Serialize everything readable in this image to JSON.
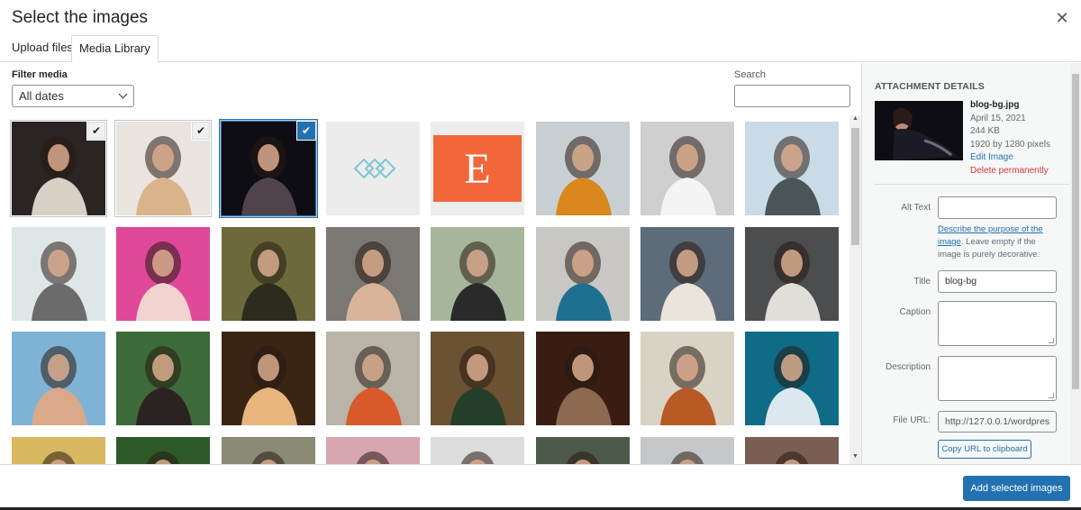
{
  "modal": {
    "title": "Select the images",
    "close_icon": "close-icon"
  },
  "tabs": [
    {
      "label": "Upload files",
      "active": false
    },
    {
      "label": "Media Library",
      "active": true
    }
  ],
  "toolbar": {
    "filter_label": "Filter media",
    "filter_value": "All dates",
    "search_label": "Search",
    "search_value": ""
  },
  "grid": {
    "tiles": [
      {
        "row": 0,
        "col": 0,
        "bg": "#2a2522",
        "fg": "#d8cfc5",
        "selected": true,
        "focused": false,
        "check": "✔"
      },
      {
        "row": 0,
        "col": 1,
        "bg": "#e9e4df",
        "fg": "#d9b48a",
        "selected": true,
        "focused": false,
        "check": "✔"
      },
      {
        "row": 0,
        "col": 2,
        "bg": "#0e0d14",
        "fg": "#51434a",
        "selected": true,
        "focused": true,
        "check": "✔"
      },
      {
        "row": 0,
        "col": 3,
        "bg": "#ececec",
        "fg": "#7fc6d2",
        "selected": false,
        "focused": false,
        "check": ""
      },
      {
        "row": 0,
        "col": 4,
        "bg": "#ededed",
        "fg": "#f26639",
        "selected": false,
        "focused": false,
        "check": ""
      },
      {
        "row": 0,
        "col": 5,
        "bg": "#c8cfd2",
        "fg": "#d9861c",
        "selected": false,
        "focused": false,
        "check": ""
      },
      {
        "row": 0,
        "col": 6,
        "bg": "#cfcfcf",
        "fg": "#f4f4f4",
        "selected": false,
        "focused": false,
        "check": ""
      },
      {
        "row": 0,
        "col": 7,
        "bg": "#c9dbe6",
        "fg": "#4a5558",
        "selected": false,
        "focused": false,
        "check": ""
      },
      {
        "row": 1,
        "col": 0,
        "bg": "#dfe6e8",
        "fg": "#6b6b6b",
        "selected": false,
        "focused": false,
        "check": ""
      },
      {
        "row": 1,
        "col": 1,
        "bg": "#e0489a",
        "fg": "#f1d3cf",
        "selected": false,
        "focused": false,
        "check": ""
      },
      {
        "row": 1,
        "col": 2,
        "bg": "#6c6a3c",
        "fg": "#2c2c1e",
        "selected": false,
        "focused": false,
        "check": ""
      },
      {
        "row": 1,
        "col": 3,
        "bg": "#7b7772",
        "fg": "#d9b49a",
        "selected": false,
        "focused": false,
        "check": ""
      },
      {
        "row": 1,
        "col": 4,
        "bg": "#a7b69a",
        "fg": "#2a2a2a",
        "selected": false,
        "focused": false,
        "check": ""
      },
      {
        "row": 1,
        "col": 5,
        "bg": "#c9c7c3",
        "fg": "#1f6f91",
        "selected": false,
        "focused": false,
        "check": ""
      },
      {
        "row": 1,
        "col": 6,
        "bg": "#5d6c78",
        "fg": "#e9e4dc",
        "selected": false,
        "focused": false,
        "check": ""
      },
      {
        "row": 1,
        "col": 7,
        "bg": "#4b4d4f",
        "fg": "#e1ddd7",
        "selected": false,
        "focused": false,
        "check": ""
      },
      {
        "row": 2,
        "col": 0,
        "bg": "#7fb3d6",
        "fg": "#d9a98a",
        "selected": false,
        "focused": false,
        "check": ""
      },
      {
        "row": 2,
        "col": 1,
        "bg": "#3d6b3a",
        "fg": "#2b2322",
        "selected": false,
        "focused": false,
        "check": ""
      },
      {
        "row": 2,
        "col": 2,
        "bg": "#3a2414",
        "fg": "#e8b67c",
        "selected": false,
        "focused": false,
        "check": ""
      },
      {
        "row": 2,
        "col": 3,
        "bg": "#b9b3a8",
        "fg": "#d85a2b",
        "selected": false,
        "focused": false,
        "check": ""
      },
      {
        "row": 2,
        "col": 4,
        "bg": "#6b5233",
        "fg": "#253e29",
        "selected": false,
        "focused": false,
        "check": ""
      },
      {
        "row": 2,
        "col": 5,
        "bg": "#3a1d12",
        "fg": "#8d6a4f",
        "selected": false,
        "focused": false,
        "check": ""
      },
      {
        "row": 2,
        "col": 6,
        "bg": "#d9d3c6",
        "fg": "#b85a26",
        "selected": false,
        "focused": false,
        "check": ""
      },
      {
        "row": 2,
        "col": 7,
        "bg": "#0f6b86",
        "fg": "#dbe8ef",
        "selected": false,
        "focused": false,
        "check": ""
      },
      {
        "row": 3,
        "col": 0,
        "bg": "#d8b860",
        "fg": "#e7c9a2",
        "selected": false,
        "focused": false,
        "check": ""
      },
      {
        "row": 3,
        "col": 1,
        "bg": "#2e5a2a",
        "fg": "#8c6a50",
        "selected": false,
        "focused": false,
        "check": ""
      },
      {
        "row": 3,
        "col": 2,
        "bg": "#8a8a75",
        "fg": "#c7c6b6",
        "selected": false,
        "focused": false,
        "check": ""
      },
      {
        "row": 3,
        "col": 3,
        "bg": "#d8a6b0",
        "fg": "#a57a6c",
        "selected": false,
        "focused": false,
        "check": ""
      },
      {
        "row": 3,
        "col": 4,
        "bg": "#dcdcdc",
        "fg": "#c2302f",
        "selected": false,
        "focused": false,
        "check": ""
      },
      {
        "row": 3,
        "col": 5,
        "bg": "#4d5a4a",
        "fg": "#8e9a86",
        "selected": false,
        "focused": false,
        "check": ""
      },
      {
        "row": 3,
        "col": 6,
        "bg": "#c5c8ca",
        "fg": "#6b6f73",
        "selected": false,
        "focused": false,
        "check": ""
      },
      {
        "row": 3,
        "col": 7,
        "bg": "#7a5e52",
        "fg": "#2a1d18",
        "selected": false,
        "focused": false,
        "check": ""
      }
    ]
  },
  "details": {
    "heading": "ATTACHMENT DETAILS",
    "filename": "blog-bg.jpg",
    "date": "April 15, 2021",
    "size": "244 KB",
    "dimensions": "1920 by 1280 pixels",
    "edit_label": "Edit Image",
    "delete_label": "Delete permanently",
    "alt_label": "Alt Text",
    "alt_value": "",
    "help_link": "Describe the purpose of the image",
    "help_text": ". Leave empty if the image is purely decorative.",
    "title_label": "Title",
    "title_value": "blog-bg",
    "caption_label": "Caption",
    "caption_value": "",
    "description_label": "Description",
    "description_value": "",
    "url_label": "File URL:",
    "url_value": "http://127.0.0.1/wordpres",
    "copy_label": "Copy URL to clipboard"
  },
  "footer": {
    "add_label": "Add selected images"
  },
  "colors": {
    "accent": "#2271b1",
    "danger": "#d63638"
  }
}
